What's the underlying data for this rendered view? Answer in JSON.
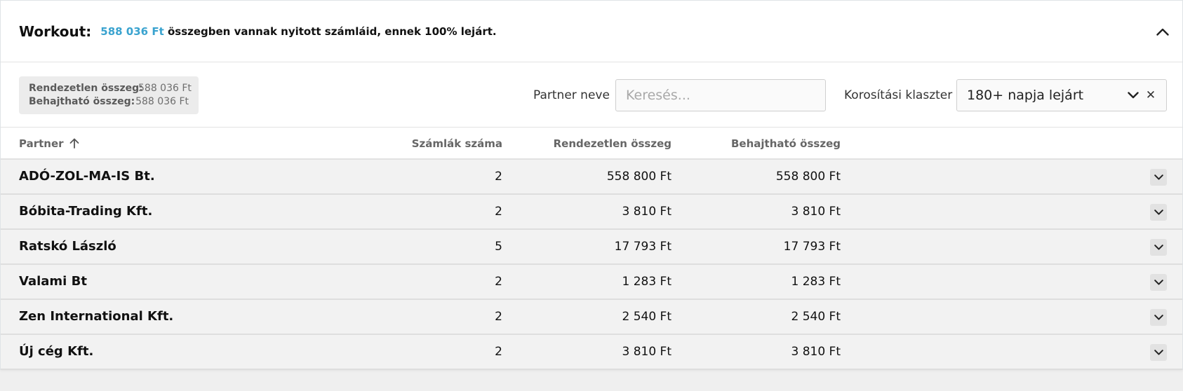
{
  "header": {
    "title": "Workout:",
    "amount": "588 036 Ft",
    "summary_text": " összegben vannak nyitott számláid, ennek 100% lejárt."
  },
  "totals": {
    "unsettled_label": "Rendezetlen összeg:",
    "unsettled_value": "588 036 Ft",
    "collectible_label": "Behajtható összeg:",
    "collectible_value": "588 036 Ft"
  },
  "filters": {
    "partner_label": "Partner neve",
    "partner_placeholder": "Keresés...",
    "partner_value": "",
    "cluster_label": "Korosítási klaszter",
    "cluster_value": "180+ napja lejárt"
  },
  "table": {
    "columns": {
      "partner": "Partner",
      "invoice_count": "Számlák száma",
      "unsettled": "Rendezetlen összeg",
      "collectible": "Behajtható összeg"
    },
    "sort": {
      "column": "partner",
      "direction": "ascending"
    },
    "rows": [
      {
        "partner": "ADÓ-ZOL-MA-IS Bt.",
        "invoice_count": "2",
        "unsettled": "558 800 Ft",
        "collectible": "558 800 Ft"
      },
      {
        "partner": "Bóbita-Trading Kft.",
        "invoice_count": "2",
        "unsettled": "3 810 Ft",
        "collectible": "3 810 Ft"
      },
      {
        "partner": "Ratskó László",
        "invoice_count": "5",
        "unsettled": "17 793 Ft",
        "collectible": "17 793 Ft"
      },
      {
        "partner": "Valami Bt",
        "invoice_count": "2",
        "unsettled": "1 283 Ft",
        "collectible": "1 283 Ft"
      },
      {
        "partner": "Zen International Kft.",
        "invoice_count": "2",
        "unsettled": "2 540 Ft",
        "collectible": "2 540 Ft"
      },
      {
        "partner": "Új cég Kft.",
        "invoice_count": "2",
        "unsettled": "3 810 Ft",
        "collectible": "3 810 Ft"
      }
    ]
  },
  "colors": {
    "accent": "#3aa3cf",
    "row_background": "#f2f2f2",
    "page_background": "#efefef"
  },
  "icons": {
    "collapse": "chevron-up-icon",
    "sort": "arrow-up-icon",
    "select_dropdown": "chevron-down-icon",
    "select_clear": "close-icon",
    "row_expand": "chevron-down-icon"
  }
}
